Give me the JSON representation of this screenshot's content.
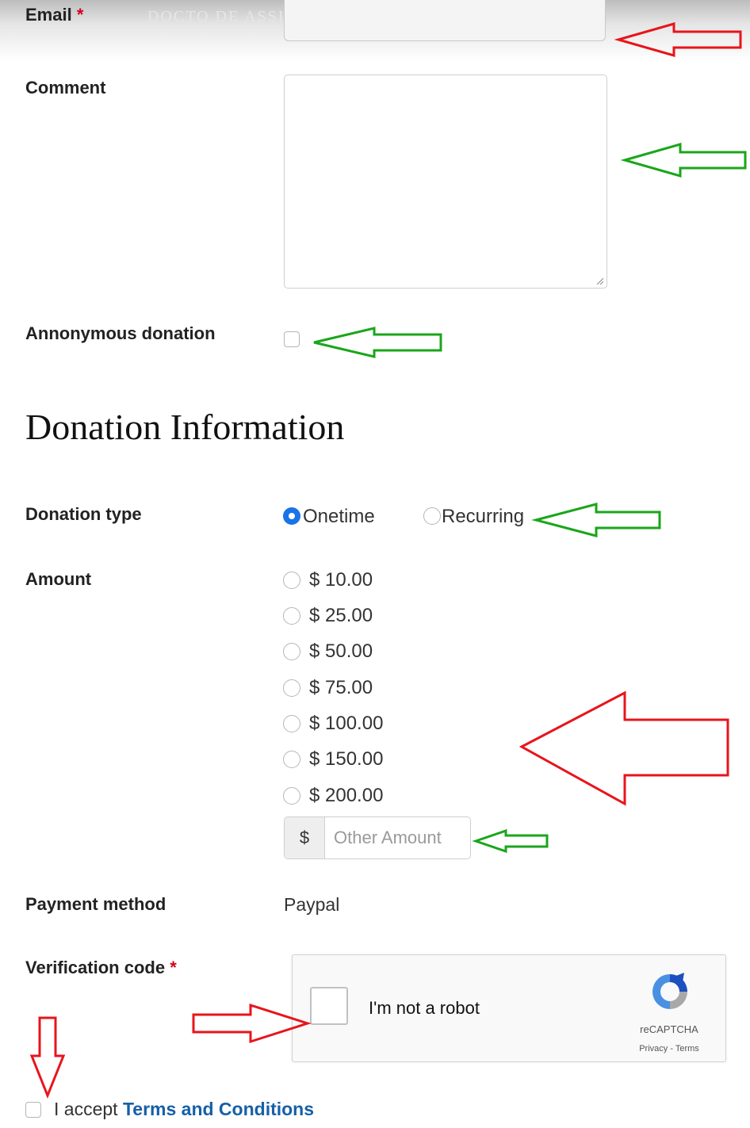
{
  "email": {
    "label": "Email",
    "required_mark": "*",
    "ghost_text": "DOCTO DE ASSINORA"
  },
  "comment": {
    "label": "Comment"
  },
  "anonymous": {
    "label": "Annonymous donation"
  },
  "section_title": "Donation Information",
  "donation_type": {
    "label": "Donation type",
    "options": [
      "Onetime",
      "Recurring"
    ],
    "selected": "Onetime"
  },
  "amount": {
    "label": "Amount",
    "options": [
      "$ 10.00",
      "$ 25.00",
      "$ 50.00",
      "$ 75.00",
      "$ 100.00",
      "$ 150.00",
      "$ 200.00"
    ],
    "currency_addon": "$",
    "other_placeholder": "Other Amount"
  },
  "payment": {
    "label": "Payment method",
    "value": "Paypal"
  },
  "verification": {
    "label": "Verification code",
    "required_mark": "*",
    "recaptcha_text": "I'm not a robot",
    "recaptcha_brand": "reCAPTCHA",
    "recaptcha_links": "Privacy - Terms"
  },
  "terms": {
    "prefix": "I accept",
    "link": "Terms and Conditions"
  },
  "colors": {
    "arrow_red": "#e8141b",
    "arrow_green": "#1aa61a",
    "link": "#1560a8",
    "radio_selected": "#1a73e8"
  },
  "icons": [
    "recaptcha-logo-icon",
    "resize-handle-icon"
  ]
}
